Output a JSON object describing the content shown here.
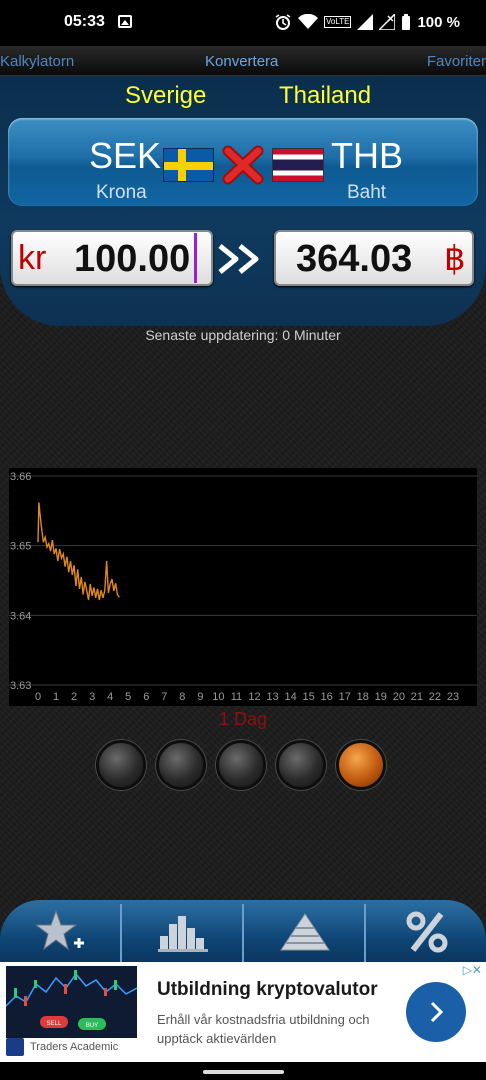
{
  "status_bar": {
    "time": "05:33",
    "battery": "100 %",
    "network": "VoLTE"
  },
  "top_tabs": {
    "left": "Kalkylatorn",
    "middle": "Konvertera",
    "right": "Favoriter"
  },
  "from": {
    "country": "Sverige",
    "code": "SEK",
    "name": "Krona",
    "symbol": "kr",
    "amount": "100.00"
  },
  "to": {
    "country": "Thailand",
    "code": "THB",
    "name": "Baht",
    "symbol": "฿",
    "amount": "364.03"
  },
  "last_update": "Senaste uppdatering: 0 Minuter",
  "period_label": "1 Dag",
  "period_buttons": [
    {
      "name": "period-button-1",
      "active": false
    },
    {
      "name": "period-button-2",
      "active": false
    },
    {
      "name": "period-button-3",
      "active": false
    },
    {
      "name": "period-button-4",
      "active": false
    },
    {
      "name": "period-button-5",
      "active": true
    }
  ],
  "chart_data": {
    "type": "line",
    "xlabel": "",
    "ylabel": "",
    "xlim": [
      0,
      24
    ],
    "ylim": [
      3.63,
      3.66
    ],
    "x_ticks": [
      "0",
      "1",
      "2",
      "3",
      "4",
      "5",
      "6",
      "7",
      "8",
      "9",
      "10",
      "11",
      "12",
      "13",
      "14",
      "15",
      "16",
      "17",
      "18",
      "19",
      "20",
      "21",
      "22",
      "23"
    ],
    "y_ticks": [
      "3.66",
      "3.65",
      "3.64",
      "3.63"
    ],
    "grid": true,
    "series": [
      {
        "color": "#e08a1e",
        "x": [
          0.0,
          0.05,
          0.1,
          0.2,
          0.3,
          0.4,
          0.5,
          0.6,
          0.7,
          0.8,
          0.9,
          1.0,
          1.1,
          1.2,
          1.3,
          1.4,
          1.5,
          1.6,
          1.7,
          1.8,
          1.9,
          2.0,
          2.1,
          2.2,
          2.3,
          2.4,
          2.5,
          2.6,
          2.7,
          2.8,
          2.9,
          3.0,
          3.1,
          3.2,
          3.3,
          3.4,
          3.5,
          3.6,
          3.7,
          3.8,
          3.9,
          4.0,
          4.1,
          4.2,
          4.3,
          4.4,
          4.5
        ],
        "y": [
          3.6505,
          3.6562,
          3.6548,
          3.6525,
          3.6505,
          3.6512,
          3.6498,
          3.6503,
          3.6492,
          3.6508,
          3.6488,
          3.6496,
          3.6478,
          3.6495,
          3.6482,
          3.6488,
          3.647,
          3.6484,
          3.6462,
          3.6478,
          3.6458,
          3.6472,
          3.6442,
          3.6466,
          3.6438,
          3.6455,
          3.643,
          3.6448,
          3.6436,
          3.6422,
          3.6445,
          3.6428,
          3.644,
          3.6425,
          3.6438,
          3.6422,
          3.6436,
          3.6425,
          3.6436,
          3.6478,
          3.6432,
          3.6445,
          3.6452,
          3.6435,
          3.6446,
          3.643,
          3.6426
        ]
      }
    ]
  },
  "ad": {
    "title": "Utbildning kryptovalutor",
    "description": "Erhåll vår kostnadsfria utbildning och upptäck aktievärlden",
    "brand": "Traders Academic",
    "sell_label": "SELL",
    "buy_label": "BUY"
  }
}
